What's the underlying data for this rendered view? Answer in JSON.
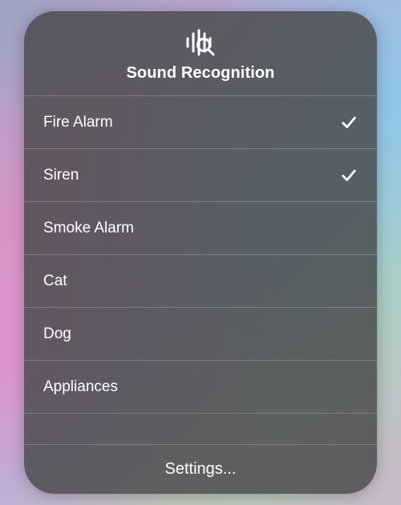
{
  "panel": {
    "title": "Sound Recognition",
    "icon": "sound-recognition-icon",
    "settingsLabel": "Settings..."
  },
  "sounds": [
    {
      "label": "Fire Alarm",
      "checked": true
    },
    {
      "label": "Siren",
      "checked": true
    },
    {
      "label": "Smoke Alarm",
      "checked": false
    },
    {
      "label": "Cat",
      "checked": false
    },
    {
      "label": "Dog",
      "checked": false
    },
    {
      "label": "Appliances",
      "checked": false
    }
  ]
}
